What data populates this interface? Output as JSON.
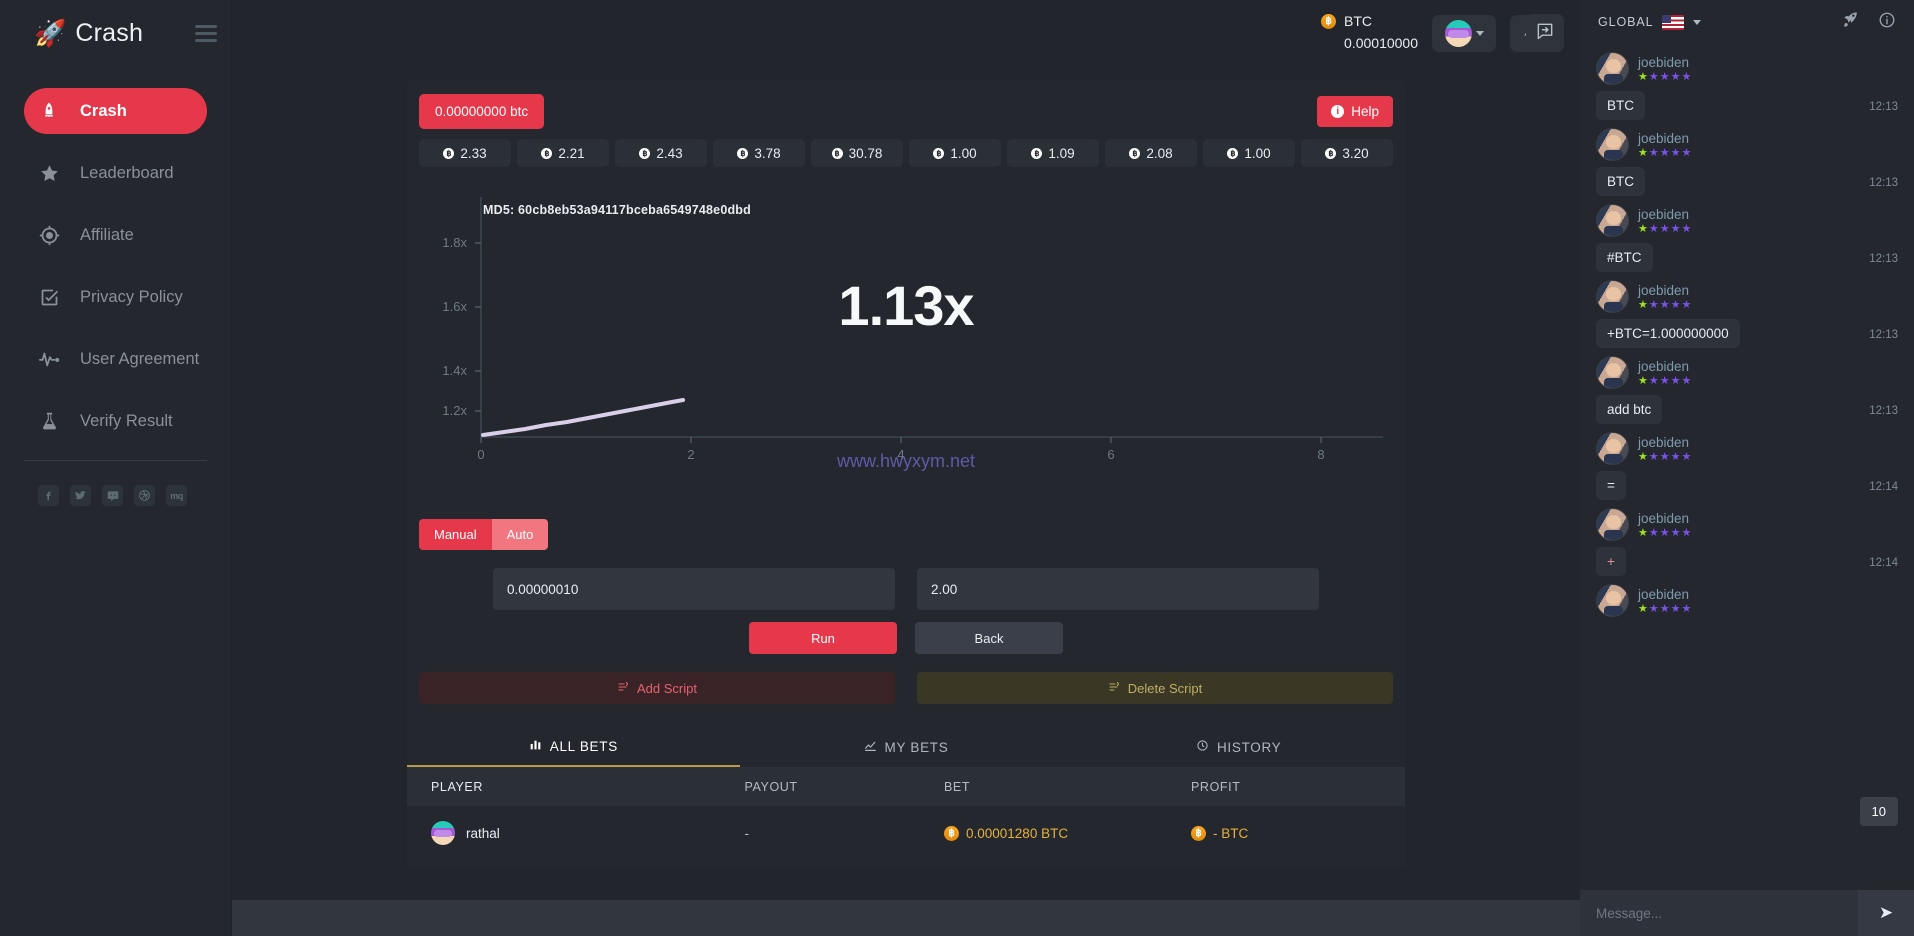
{
  "brand": {
    "logo": "🚀",
    "name": "Crash"
  },
  "sidebar": {
    "items": [
      {
        "label": "Crash",
        "icon": "rocket-icon"
      },
      {
        "label": "Leaderboard",
        "icon": "star-icon"
      },
      {
        "label": "Affiliate",
        "icon": "target-icon"
      },
      {
        "label": "Privacy Policy",
        "icon": "checkbox-icon"
      },
      {
        "label": "User Agreement",
        "icon": "pulse-icon"
      },
      {
        "label": "Verify Result",
        "icon": "flask-icon"
      }
    ],
    "socials": [
      {
        "name": "facebook-icon",
        "glyph": "f"
      },
      {
        "name": "twitter-icon",
        "glyph": "t"
      },
      {
        "name": "discord-icon",
        "glyph": "d"
      },
      {
        "name": "dribbble-icon",
        "glyph": "b"
      },
      {
        "name": "mq-icon",
        "glyph": "mq"
      }
    ]
  },
  "topbar": {
    "currency": "BTC",
    "balance": "0.00010000",
    "bell": "bell-icon",
    "chat_toggle": "chat-toggle-icon"
  },
  "game": {
    "bet_chip": "0.00000000 btc",
    "help_label": "Help",
    "history": [
      {
        "value": "2.33"
      },
      {
        "value": "2.21"
      },
      {
        "value": "2.43"
      },
      {
        "value": "3.78"
      },
      {
        "value": "30.78"
      },
      {
        "value": "1.00"
      },
      {
        "value": "1.09"
      },
      {
        "value": "2.08"
      },
      {
        "value": "1.00"
      },
      {
        "value": "3.20"
      }
    ],
    "md5": "MD5: 60cb8eb53a94117bceba6549748e0dbd",
    "multiplier": "1.13x",
    "watermark": "www.hwyxym.net"
  },
  "chart_data": {
    "type": "line",
    "title": "",
    "xlabel": "",
    "ylabel": "",
    "x_ticks": [
      "0",
      "2",
      "4",
      "6",
      "8"
    ],
    "y_ticks": [
      "1.2x",
      "1.4x",
      "1.6x",
      "1.8x"
    ],
    "xlim": [
      0,
      9.4
    ],
    "ylim": [
      1.0,
      1.9
    ],
    "grid": false,
    "legend": "none",
    "line_color": "#d9cfe9",
    "x": [
      0.0,
      0.2,
      0.4,
      0.6,
      0.8,
      1.0,
      1.2,
      1.4,
      1.6,
      1.8,
      1.9
    ],
    "y": [
      1.0,
      1.012,
      1.026,
      1.04,
      1.054,
      1.068,
      1.082,
      1.096,
      1.11,
      1.124,
      1.13
    ]
  },
  "controls": {
    "mode_manual": "Manual",
    "mode_auto": "Auto",
    "bet_amount": "0.00000010",
    "auto_cashout": "2.00",
    "run_label": "Run",
    "back_label": "Back",
    "add_script": "Add Script",
    "delete_script": "Delete Script"
  },
  "bets": {
    "tabs": [
      {
        "label": "ALL BETS",
        "icon": "bar-chart-icon"
      },
      {
        "label": "MY BETS",
        "icon": "chart-icon"
      },
      {
        "label": "HISTORY",
        "icon": "clock-icon"
      }
    ],
    "columns": [
      "PLAYER",
      "PAYOUT",
      "BET",
      "PROFIT"
    ],
    "rows": [
      {
        "player": "rathal",
        "payout": "-",
        "bet": "0.00001280 BTC",
        "profit": "- BTC"
      }
    ]
  },
  "chat": {
    "scope": "GLOBAL",
    "flag": "us-flag-icon",
    "rocket": "rocket-icon",
    "info": "info-icon",
    "unread": "10",
    "placeholder": "Message...",
    "send": "➤",
    "messages": [
      {
        "user": "joebiden",
        "text": "BTC",
        "time": "12:13"
      },
      {
        "user": "joebiden",
        "text": "BTC",
        "time": "12:13"
      },
      {
        "user": "joebiden",
        "text": "#BTC",
        "time": "12:13"
      },
      {
        "user": "joebiden",
        "text": "+BTC=1.000000000",
        "time": "12:13"
      },
      {
        "user": "joebiden",
        "text": "add btc",
        "time": "12:13"
      },
      {
        "user": "joebiden",
        "text": "=",
        "time": "12:14"
      },
      {
        "user": "joebiden",
        "text": "+",
        "time": "12:14"
      },
      {
        "user": "joebiden",
        "text": "",
        "time": ""
      }
    ]
  },
  "colors": {
    "accent": "#e6384b",
    "panel": "#24272d",
    "page": "#22252b",
    "gold": "#b79b4a",
    "btc": "#e5b23c"
  }
}
